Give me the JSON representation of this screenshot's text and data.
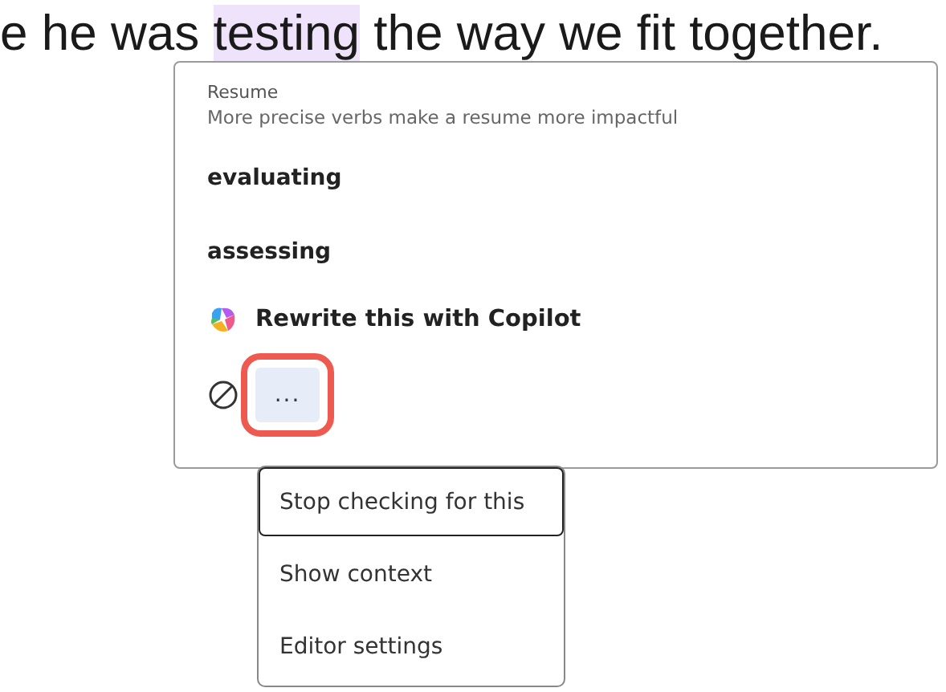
{
  "document": {
    "before": "e he was ",
    "flagged": "testing",
    "after": " the way we fit together."
  },
  "card": {
    "category": "Resume",
    "description": "More precise verbs make a resume more impactful",
    "suggestions": [
      "evaluating",
      "assessing"
    ],
    "copilot_action": "Rewrite this with Copilot",
    "more_button": {
      "label": "...",
      "highlighted": true
    }
  },
  "menu": [
    {
      "label": "Stop checking for this",
      "selected": true
    },
    {
      "label": "Show context",
      "selected": false
    },
    {
      "label": "Editor settings",
      "selected": false
    }
  ]
}
